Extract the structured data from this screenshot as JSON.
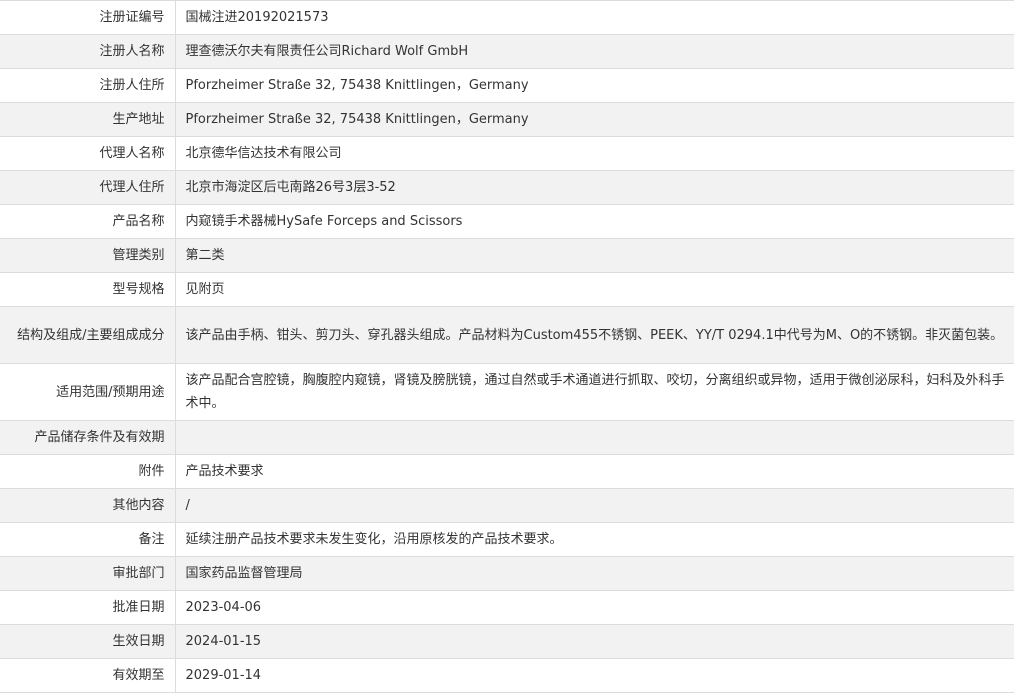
{
  "rows": [
    {
      "label": "注册证编号",
      "value": "国械注进20192021573"
    },
    {
      "label": "注册人名称",
      "value": "理查德沃尔夫有限责任公司Richard Wolf GmbH"
    },
    {
      "label": "注册人住所",
      "value": "Pforzheimer Straße 32, 75438 Knittlingen，Germany"
    },
    {
      "label": "生产地址",
      "value": "Pforzheimer Straße 32, 75438 Knittlingen，Germany"
    },
    {
      "label": "代理人名称",
      "value": "北京德华信达技术有限公司"
    },
    {
      "label": "代理人住所",
      "value": "北京市海淀区后屯南路26号3层3-52"
    },
    {
      "label": "产品名称",
      "value": "内窥镜手术器械HySafe Forceps and Scissors"
    },
    {
      "label": "管理类别",
      "value": "第二类"
    },
    {
      "label": "型号规格",
      "value": "见附页"
    },
    {
      "label": "结构及组成/主要组成成分",
      "value": "该产品由手柄、钳头、剪刀头、穿孔器头组成。产品材料为Custom455不锈钢、PEEK、YY/T 0294.1中代号为M、O的不锈钢。非灭菌包装。"
    },
    {
      "label": "适用范围/预期用途",
      "value": "该产品配合宫腔镜，胸腹腔内窥镜，肾镜及膀胱镜，通过自然或手术通道进行抓取、咬切，分离组织或异物，适用于微创泌尿科，妇科及外科手术中。"
    },
    {
      "label": "产品储存条件及有效期",
      "value": ""
    },
    {
      "label": "附件",
      "value": "产品技术要求"
    },
    {
      "label": "其他内容",
      "value": "/"
    },
    {
      "label": "备注",
      "value": "延续注册产品技术要求未发生变化，沿用原核发的产品技术要求。"
    },
    {
      "label": "审批部门",
      "value": "国家药品监督管理局"
    },
    {
      "label": "批准日期",
      "value": "2023-04-06"
    },
    {
      "label": "生效日期",
      "value": "2024-01-15"
    },
    {
      "label": "有效期至",
      "value": "2029-01-14"
    }
  ]
}
